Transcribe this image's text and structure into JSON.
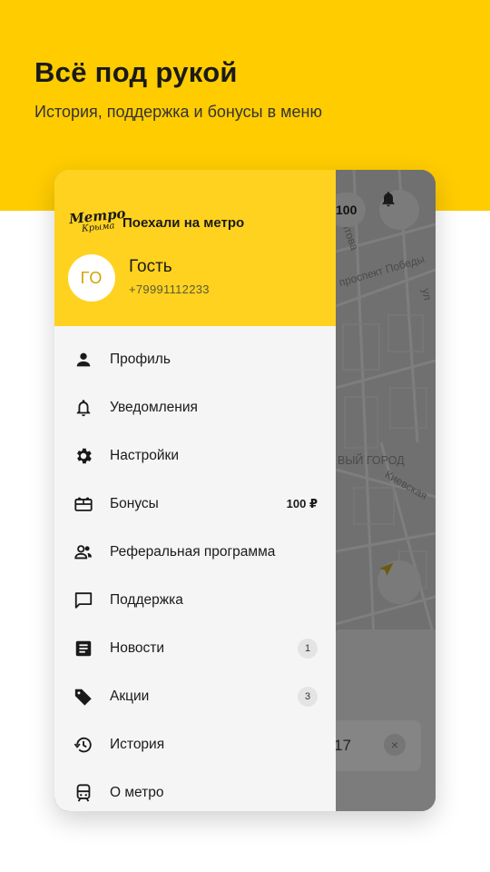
{
  "promo": {
    "title": "Всё под рукой",
    "subtitle": "История, поддержка и бонусы в меню"
  },
  "map": {
    "balance_pill": "100",
    "labels": [
      "итова",
      "проспект Победы",
      "ВЫЙ ГОРОД",
      "Киевская",
      "ул"
    ],
    "sheet_value": "17",
    "sheet_close": "×"
  },
  "drawer": {
    "logo_line1": "Метро",
    "logo_line2": "Крыма",
    "header_title": "Поехали на метро",
    "avatar_initials": "ГО",
    "user_name": "Гость",
    "user_phone": "+79991112233",
    "items": [
      {
        "label": "Профиль",
        "icon": "person-icon"
      },
      {
        "label": "Уведомления",
        "icon": "bell-icon"
      },
      {
        "label": "Настройки",
        "icon": "gear-icon"
      },
      {
        "label": "Бонусы",
        "icon": "gift-card-icon",
        "value": "100 ₽"
      },
      {
        "label": "Реферальная программа",
        "icon": "people-icon"
      },
      {
        "label": "Поддержка",
        "icon": "chat-icon"
      },
      {
        "label": "Новости",
        "icon": "news-icon",
        "badge": "1"
      },
      {
        "label": "Акции",
        "icon": "tag-icon",
        "badge": "3"
      },
      {
        "label": "История",
        "icon": "history-icon"
      },
      {
        "label": "О метро",
        "icon": "metro-train-icon"
      }
    ]
  },
  "colors": {
    "brand_yellow": "#FFCC00",
    "drawer_header_yellow": "#FFD21F",
    "map_overlay": "#707070"
  }
}
